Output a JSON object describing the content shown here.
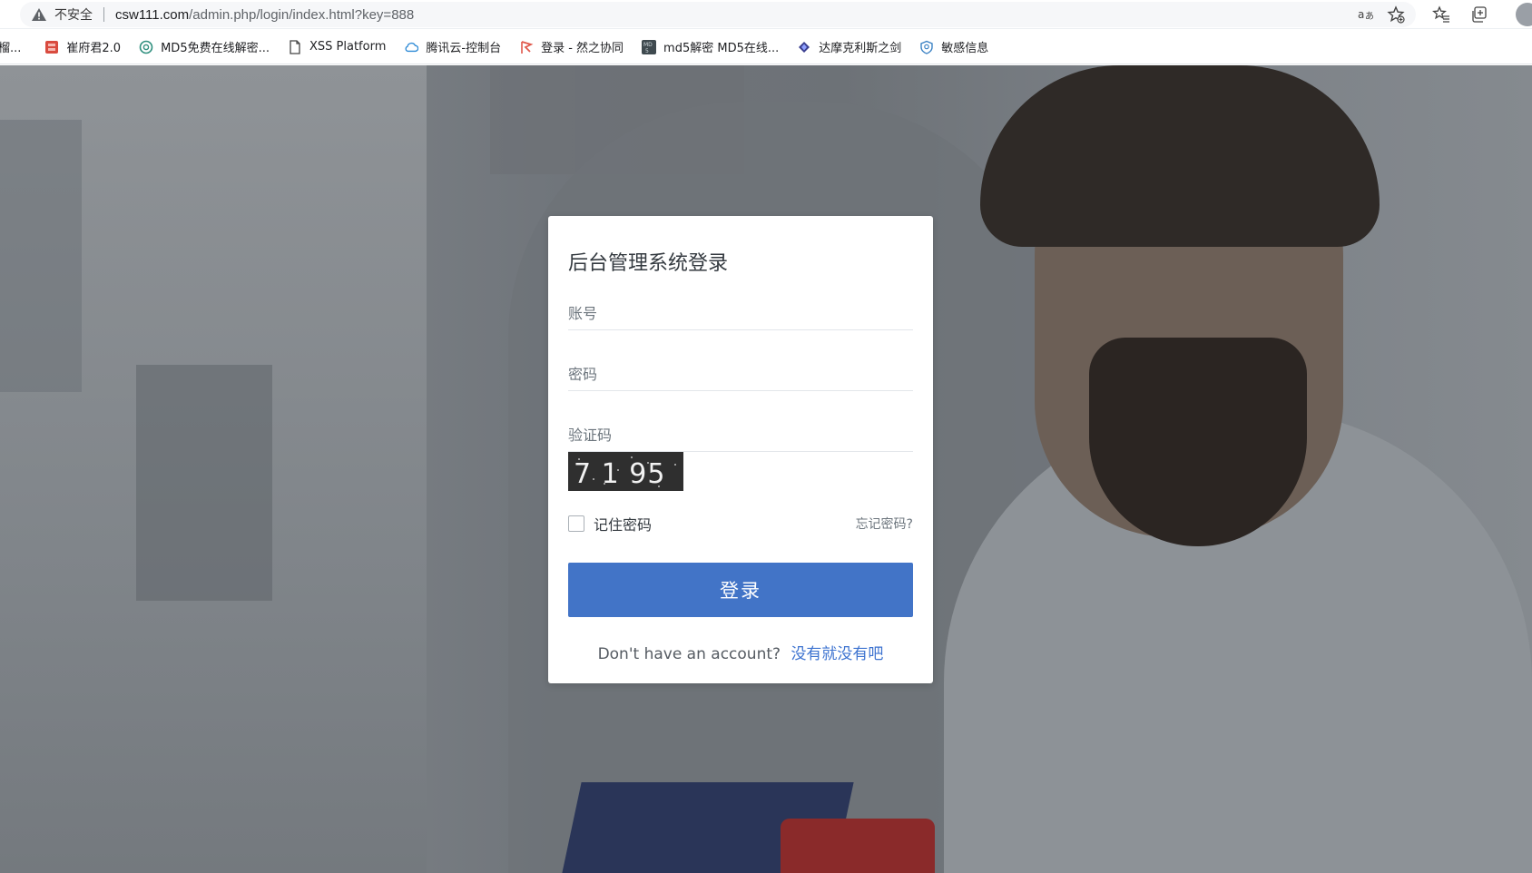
{
  "browser": {
    "security_label": "不安全",
    "url_host": "csw111.com",
    "url_path": "/admin.php/login/index.html?key=888",
    "bookmarks": [
      {
        "label": "榴...",
        "icon": "bookmark-icon"
      },
      {
        "label": "崔府君2.0",
        "icon": "red-square-icon"
      },
      {
        "label": "MD5免费在线解密...",
        "icon": "openai-icon"
      },
      {
        "label": "XSS Platform",
        "icon": "page-icon"
      },
      {
        "label": "腾讯云-控制台",
        "icon": "cloud-icon"
      },
      {
        "label": "登录 - 然之协同",
        "icon": "flag-icon"
      },
      {
        "label": "md5解密 MD5在线...",
        "icon": "md5-icon"
      },
      {
        "label": "达摩克利斯之剑",
        "icon": "diamond-icon"
      },
      {
        "label": "敏感信息",
        "icon": "shield-icon"
      }
    ]
  },
  "login": {
    "title": "后台管理系统登录",
    "username_placeholder": "账号",
    "password_placeholder": "密码",
    "captcha_placeholder": "验证码",
    "captcha_text": "7 1 95",
    "remember_label": "记住密码",
    "forgot_label": "忘记密码?",
    "submit_label": "登录",
    "signup_prompt": "Don't have an account?",
    "signup_link": "没有就没有吧"
  },
  "colors": {
    "accent": "#4274c7",
    "link": "#3d73d0"
  }
}
